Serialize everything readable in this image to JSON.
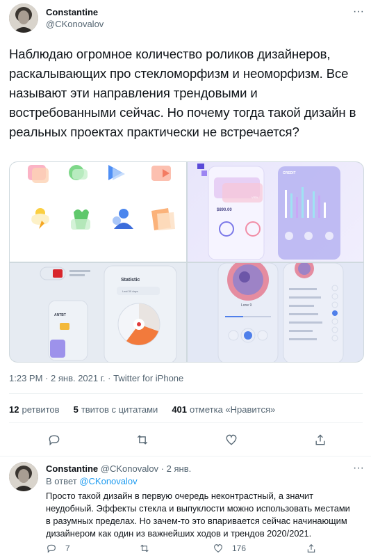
{
  "tweet": {
    "author_name": "Constantine",
    "author_handle": "@CKonovalov",
    "more_icon": "more-horizontal-icon",
    "text": "Наблюдаю огромное количество роликов дизайнеров, раскалывающих про стекломорфизм и неоморфизм. Все называют эти направления трендовыми и востребованными сейчас. Но почему тогда такой дизайн в реальных проектах практически не встречается?",
    "time": "1:23 PM",
    "date": "2 янв. 2021 г.",
    "source": "Twitter for iPhone",
    "meta_separator": "·",
    "stats": {
      "retweets_count": "12",
      "retweets_label": "ретвитов",
      "quotes_count": "5",
      "quotes_label": "твитов с цитатами",
      "likes_count": "401",
      "likes_label": "отметка «Нравится»"
    },
    "media": {
      "card_visa": "VISA",
      "card_amount": "$890.00",
      "credit_label": "CREDIT",
      "statistic_label": "Statistic",
      "statistic_filter": "Last 30 days",
      "card_bank": "ANTBT",
      "player_track": "Lone 9"
    }
  },
  "reply": {
    "author_name": "Constantine",
    "author_handle": "@CKonovalov",
    "separator": "·",
    "date": "2 янв.",
    "reply_to_prefix": "В ответ",
    "reply_to_handle": "@CKonovalov",
    "text": "Просто такой дизайн в первую очередь неконтрастный, а значит неудобный. Эффекты стекла и выпуклости можно использовать местами в разумных пределах. Но зачем-то это впаривается сейчас начинающим дизайнером как один из важнейших ходов и трендов 2020/2021.",
    "replies_count": "7",
    "likes_count": "176"
  },
  "icons": [
    "reply-icon",
    "retweet-icon",
    "like-icon",
    "share-icon"
  ],
  "colors": {
    "accent": "#1d9bf0",
    "text": "#0f1419",
    "secondary": "#536471",
    "border": "#eff3f4"
  }
}
